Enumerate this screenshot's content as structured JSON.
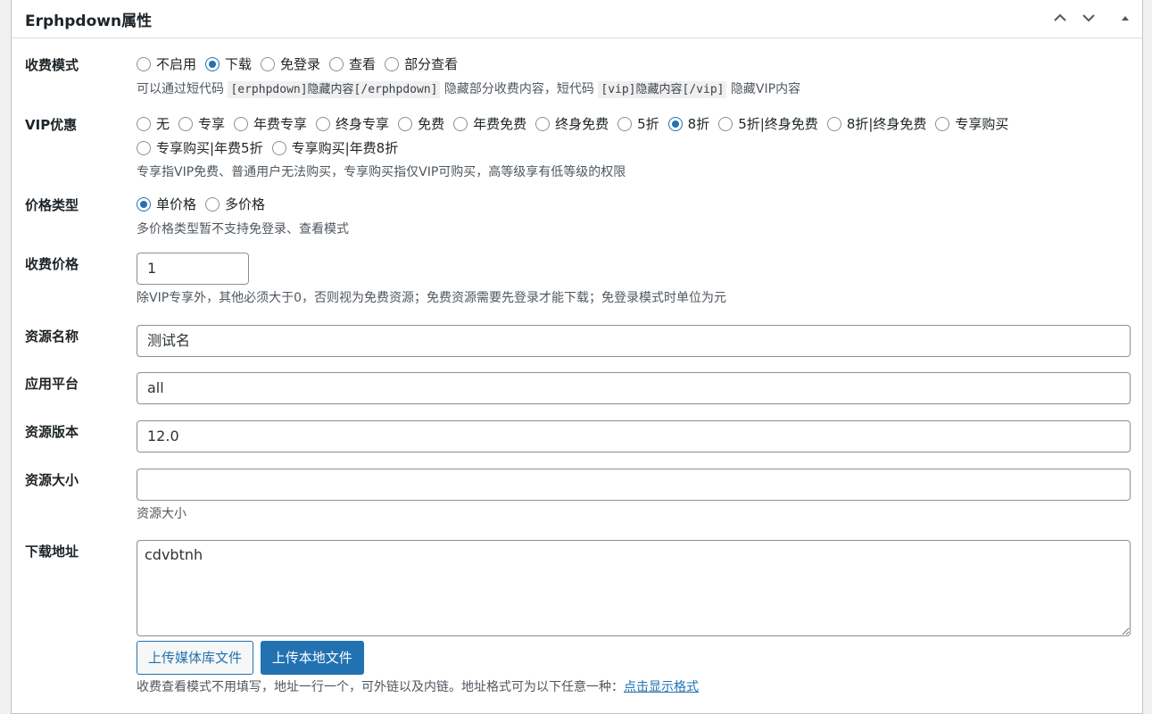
{
  "box_title": "Erphpdown属性",
  "header_icons": [
    "chevron-up-icon",
    "chevron-down-icon",
    "triangle-up-icon"
  ],
  "charge_mode": {
    "label": "收费模式",
    "options": [
      "不启用",
      "下载",
      "免登录",
      "查看",
      "部分查看"
    ],
    "selected": "下载",
    "desc_1": "可以通过短代码",
    "code_1": "[erphpdown]隐藏内容[/erphpdown]",
    "desc_2": "隐藏部分收费内容，短代码",
    "code_2": "[vip]隐藏内容[/vip]",
    "desc_3": "隐藏VIP内容"
  },
  "vip": {
    "label": "VIP优惠",
    "options": [
      "无",
      "专享",
      "年费专享",
      "终身专享",
      "免费",
      "年费免费",
      "终身免费",
      "5折",
      "8折",
      "5折|终身免费",
      "8折|终身免费",
      "专享购买",
      "专享购买|年费5折",
      "专享购买|年费8折"
    ],
    "selected": "8折",
    "desc": "专享指VIP免费、普通用户无法购买，专享购买指仅VIP可购买，高等级享有低等级的权限"
  },
  "price_type": {
    "label": "价格类型",
    "options": [
      "单价格",
      "多价格"
    ],
    "selected": "单价格",
    "desc": "多价格类型暂不支持免登录、查看模式"
  },
  "price": {
    "label": "收费价格",
    "value": "1",
    "desc": "除VIP专享外，其他必须大于0，否则视为免费资源；免费资源需要先登录才能下载；免登录模式时单位为元"
  },
  "resource_name": {
    "label": "资源名称",
    "value": "测试名"
  },
  "platform": {
    "label": "应用平台",
    "value": "all"
  },
  "version": {
    "label": "资源版本",
    "value": "12.0"
  },
  "size": {
    "label": "资源大小",
    "value": "",
    "desc": "资源大小"
  },
  "download": {
    "label": "下载地址",
    "value": "cdvbtnh",
    "upload_media_label": "上传媒体库文件",
    "upload_local_label": "上传本地文件",
    "desc": "收费查看模式不用填写，地址一行一个，可外链以及内链。地址格式可为以下任意一种：",
    "link_label": "点击显示格式"
  }
}
